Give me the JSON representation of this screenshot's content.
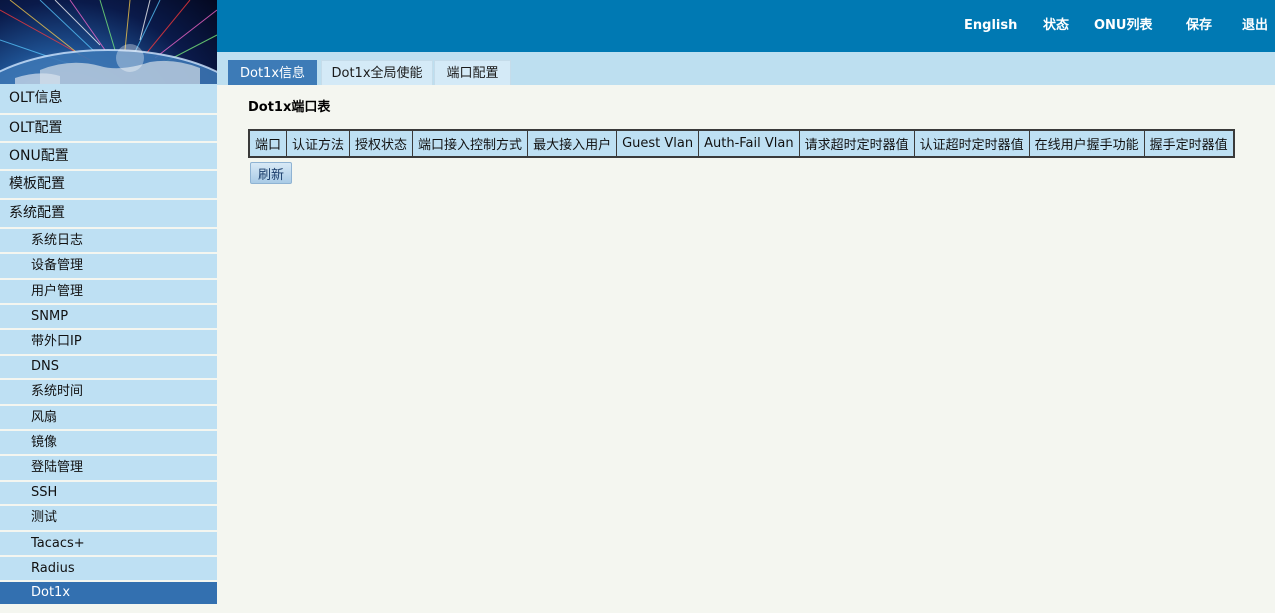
{
  "header": {
    "nav": [
      "English",
      "状态",
      "ONU列表",
      "保存",
      "退出"
    ]
  },
  "tabs": [
    "Dot1x信息",
    "Dot1x全局使能",
    "端口配置"
  ],
  "sidebar": {
    "sections": [
      "OLT信息",
      "OLT配置",
      "ONU配置",
      "模板配置",
      "系统配置"
    ],
    "items": [
      "系统日志",
      "设备管理",
      "用户管理",
      "SNMP",
      "带外口IP",
      "DNS",
      "系统时间",
      "风扇",
      "镜像",
      "登陆管理",
      "SSH",
      "测试",
      "Tacacs+",
      "Radius",
      "Dot1x"
    ]
  },
  "main": {
    "title": "Dot1x端口表",
    "columns": [
      "端口",
      "认证方法",
      "授权状态",
      "端口接入控制方式",
      "最大接入用户",
      "Guest Vlan",
      "Auth-Fail Vlan",
      "请求超时定时器值",
      "认证超时定时器值",
      "在线用户握手功能",
      "握手定时器值"
    ],
    "refresh_label": "刷新"
  },
  "colors": {
    "header": "#0079b3",
    "tab_active": "#3d7bb7",
    "sidebar_item": "#bee0f3",
    "sidebar_active": "#3370b0",
    "page_bg": "#f4f6f0"
  }
}
